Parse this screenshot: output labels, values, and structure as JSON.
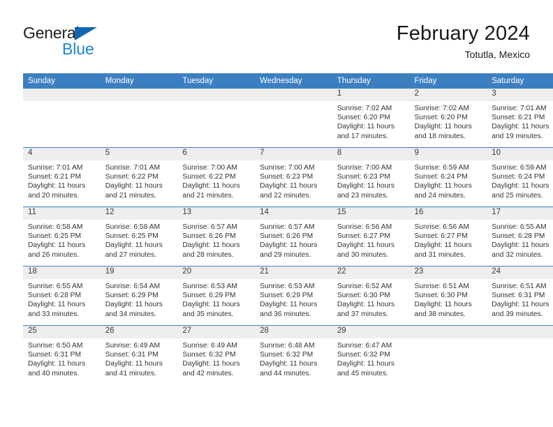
{
  "brand": {
    "name_part1": "General",
    "name_part2": "Blue",
    "triangle_color": "#1266b0",
    "blue_color": "#1c84d6"
  },
  "header": {
    "title": "February 2024",
    "subtitle": "Totutla, Mexico"
  },
  "theme": {
    "header_bg": "#3c7fc1",
    "daynum_bg": "#eeeeee",
    "row_divider": "#3c7fc1"
  },
  "weekday_headers": [
    "Sunday",
    "Monday",
    "Tuesday",
    "Wednesday",
    "Thursday",
    "Friday",
    "Saturday"
  ],
  "weeks": [
    [
      {
        "day": "",
        "sunrise": "",
        "sunset": "",
        "daylight1": "",
        "daylight2": ""
      },
      {
        "day": "",
        "sunrise": "",
        "sunset": "",
        "daylight1": "",
        "daylight2": ""
      },
      {
        "day": "",
        "sunrise": "",
        "sunset": "",
        "daylight1": "",
        "daylight2": ""
      },
      {
        "day": "",
        "sunrise": "",
        "sunset": "",
        "daylight1": "",
        "daylight2": ""
      },
      {
        "day": "1",
        "sunrise": "Sunrise: 7:02 AM",
        "sunset": "Sunset: 6:20 PM",
        "daylight1": "Daylight: 11 hours",
        "daylight2": "and 17 minutes."
      },
      {
        "day": "2",
        "sunrise": "Sunrise: 7:02 AM",
        "sunset": "Sunset: 6:20 PM",
        "daylight1": "Daylight: 11 hours",
        "daylight2": "and 18 minutes."
      },
      {
        "day": "3",
        "sunrise": "Sunrise: 7:01 AM",
        "sunset": "Sunset: 6:21 PM",
        "daylight1": "Daylight: 11 hours",
        "daylight2": "and 19 minutes."
      }
    ],
    [
      {
        "day": "4",
        "sunrise": "Sunrise: 7:01 AM",
        "sunset": "Sunset: 6:21 PM",
        "daylight1": "Daylight: 11 hours",
        "daylight2": "and 20 minutes."
      },
      {
        "day": "5",
        "sunrise": "Sunrise: 7:01 AM",
        "sunset": "Sunset: 6:22 PM",
        "daylight1": "Daylight: 11 hours",
        "daylight2": "and 21 minutes."
      },
      {
        "day": "6",
        "sunrise": "Sunrise: 7:00 AM",
        "sunset": "Sunset: 6:22 PM",
        "daylight1": "Daylight: 11 hours",
        "daylight2": "and 21 minutes."
      },
      {
        "day": "7",
        "sunrise": "Sunrise: 7:00 AM",
        "sunset": "Sunset: 6:23 PM",
        "daylight1": "Daylight: 11 hours",
        "daylight2": "and 22 minutes."
      },
      {
        "day": "8",
        "sunrise": "Sunrise: 7:00 AM",
        "sunset": "Sunset: 6:23 PM",
        "daylight1": "Daylight: 11 hours",
        "daylight2": "and 23 minutes."
      },
      {
        "day": "9",
        "sunrise": "Sunrise: 6:59 AM",
        "sunset": "Sunset: 6:24 PM",
        "daylight1": "Daylight: 11 hours",
        "daylight2": "and 24 minutes."
      },
      {
        "day": "10",
        "sunrise": "Sunrise: 6:59 AM",
        "sunset": "Sunset: 6:24 PM",
        "daylight1": "Daylight: 11 hours",
        "daylight2": "and 25 minutes."
      }
    ],
    [
      {
        "day": "11",
        "sunrise": "Sunrise: 6:58 AM",
        "sunset": "Sunset: 6:25 PM",
        "daylight1": "Daylight: 11 hours",
        "daylight2": "and 26 minutes."
      },
      {
        "day": "12",
        "sunrise": "Sunrise: 6:58 AM",
        "sunset": "Sunset: 6:25 PM",
        "daylight1": "Daylight: 11 hours",
        "daylight2": "and 27 minutes."
      },
      {
        "day": "13",
        "sunrise": "Sunrise: 6:57 AM",
        "sunset": "Sunset: 6:26 PM",
        "daylight1": "Daylight: 11 hours",
        "daylight2": "and 28 minutes."
      },
      {
        "day": "14",
        "sunrise": "Sunrise: 6:57 AM",
        "sunset": "Sunset: 6:26 PM",
        "daylight1": "Daylight: 11 hours",
        "daylight2": "and 29 minutes."
      },
      {
        "day": "15",
        "sunrise": "Sunrise: 6:56 AM",
        "sunset": "Sunset: 6:27 PM",
        "daylight1": "Daylight: 11 hours",
        "daylight2": "and 30 minutes."
      },
      {
        "day": "16",
        "sunrise": "Sunrise: 6:56 AM",
        "sunset": "Sunset: 6:27 PM",
        "daylight1": "Daylight: 11 hours",
        "daylight2": "and 31 minutes."
      },
      {
        "day": "17",
        "sunrise": "Sunrise: 6:55 AM",
        "sunset": "Sunset: 6:28 PM",
        "daylight1": "Daylight: 11 hours",
        "daylight2": "and 32 minutes."
      }
    ],
    [
      {
        "day": "18",
        "sunrise": "Sunrise: 6:55 AM",
        "sunset": "Sunset: 6:28 PM",
        "daylight1": "Daylight: 11 hours",
        "daylight2": "and 33 minutes."
      },
      {
        "day": "19",
        "sunrise": "Sunrise: 6:54 AM",
        "sunset": "Sunset: 6:29 PM",
        "daylight1": "Daylight: 11 hours",
        "daylight2": "and 34 minutes."
      },
      {
        "day": "20",
        "sunrise": "Sunrise: 6:53 AM",
        "sunset": "Sunset: 6:29 PM",
        "daylight1": "Daylight: 11 hours",
        "daylight2": "and 35 minutes."
      },
      {
        "day": "21",
        "sunrise": "Sunrise: 6:53 AM",
        "sunset": "Sunset: 6:29 PM",
        "daylight1": "Daylight: 11 hours",
        "daylight2": "and 36 minutes."
      },
      {
        "day": "22",
        "sunrise": "Sunrise: 6:52 AM",
        "sunset": "Sunset: 6:30 PM",
        "daylight1": "Daylight: 11 hours",
        "daylight2": "and 37 minutes."
      },
      {
        "day": "23",
        "sunrise": "Sunrise: 6:51 AM",
        "sunset": "Sunset: 6:30 PM",
        "daylight1": "Daylight: 11 hours",
        "daylight2": "and 38 minutes."
      },
      {
        "day": "24",
        "sunrise": "Sunrise: 6:51 AM",
        "sunset": "Sunset: 6:31 PM",
        "daylight1": "Daylight: 11 hours",
        "daylight2": "and 39 minutes."
      }
    ],
    [
      {
        "day": "25",
        "sunrise": "Sunrise: 6:50 AM",
        "sunset": "Sunset: 6:31 PM",
        "daylight1": "Daylight: 11 hours",
        "daylight2": "and 40 minutes."
      },
      {
        "day": "26",
        "sunrise": "Sunrise: 6:49 AM",
        "sunset": "Sunset: 6:31 PM",
        "daylight1": "Daylight: 11 hours",
        "daylight2": "and 41 minutes."
      },
      {
        "day": "27",
        "sunrise": "Sunrise: 6:49 AM",
        "sunset": "Sunset: 6:32 PM",
        "daylight1": "Daylight: 11 hours",
        "daylight2": "and 42 minutes."
      },
      {
        "day": "28",
        "sunrise": "Sunrise: 6:48 AM",
        "sunset": "Sunset: 6:32 PM",
        "daylight1": "Daylight: 11 hours",
        "daylight2": "and 44 minutes."
      },
      {
        "day": "29",
        "sunrise": "Sunrise: 6:47 AM",
        "sunset": "Sunset: 6:32 PM",
        "daylight1": "Daylight: 11 hours",
        "daylight2": "and 45 minutes."
      },
      {
        "day": "",
        "sunrise": "",
        "sunset": "",
        "daylight1": "",
        "daylight2": ""
      },
      {
        "day": "",
        "sunrise": "",
        "sunset": "",
        "daylight1": "",
        "daylight2": ""
      }
    ]
  ]
}
